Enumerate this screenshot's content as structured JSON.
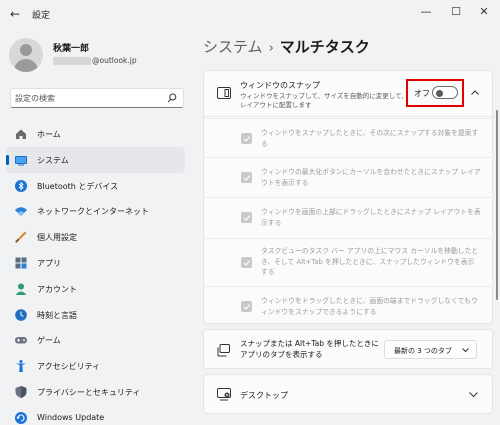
{
  "app": {
    "title": "設定"
  },
  "window_controls": {
    "minimize": "—",
    "maximize": "☐",
    "close": "✕"
  },
  "profile": {
    "name": "秋葉一郎",
    "email_suffix": "@outlook.jp"
  },
  "search": {
    "placeholder": "設定の検索"
  },
  "sidebar": {
    "items": [
      {
        "label": "ホーム",
        "icon": "home-icon"
      },
      {
        "label": "システム",
        "icon": "system-icon",
        "selected": true
      },
      {
        "label": "Bluetooth とデバイス",
        "icon": "bluetooth-icon"
      },
      {
        "label": "ネットワークとインターネット",
        "icon": "wifi-icon"
      },
      {
        "label": "個人用設定",
        "icon": "brush-icon"
      },
      {
        "label": "アプリ",
        "icon": "apps-icon"
      },
      {
        "label": "アカウント",
        "icon": "account-icon"
      },
      {
        "label": "時刻と言語",
        "icon": "time-language-icon"
      },
      {
        "label": "ゲーム",
        "icon": "gamepad-icon"
      },
      {
        "label": "アクセシビリティ",
        "icon": "accessibility-icon"
      },
      {
        "label": "プライバシーとセキュリティ",
        "icon": "shield-icon"
      },
      {
        "label": "Windows Update",
        "icon": "update-icon"
      }
    ]
  },
  "breadcrumb": {
    "parent": "システム",
    "separator": "›",
    "current": "マルチタスク"
  },
  "snap": {
    "title": "ウィンドウのスナップ",
    "description": "ウィンドウをスナップして、サイズを自動的に変更して、レイアウトに配置します",
    "toggle_label": "オフ",
    "toggle_on": false,
    "options": [
      {
        "text": "ウィンドウをスナップしたときに、その次にスナップする対象を提案する",
        "checked": true
      },
      {
        "text": "ウィンドウの最大化ボタンにカーソルを合わせたときにスナップ レイアウトを表示する",
        "checked": true
      },
      {
        "text": "ウィンドウを画面の上部にドラッグしたときにスナップ レイアウトを表示する",
        "checked": true
      },
      {
        "text": "タスクビューのタスク バー アプリの上にマウス カーソルを移動したとき、そして Alt+Tab を押したときに、スナップしたウィンドウを表示する",
        "checked": true
      },
      {
        "text": "ウィンドウをドラッグしたときに、画面の端までドラッグしなくてもウィンドウをスナップできるようにする",
        "checked": true
      }
    ]
  },
  "tabs_setting": {
    "label": "スナップまたは Alt+Tab を押したときにアプリのタブを表示する",
    "selected": "最新の 3 つのタブ"
  },
  "desktop": {
    "label": "デスクトップ"
  },
  "colors": {
    "accent": "#005fb8",
    "highlight": "#e00000"
  }
}
